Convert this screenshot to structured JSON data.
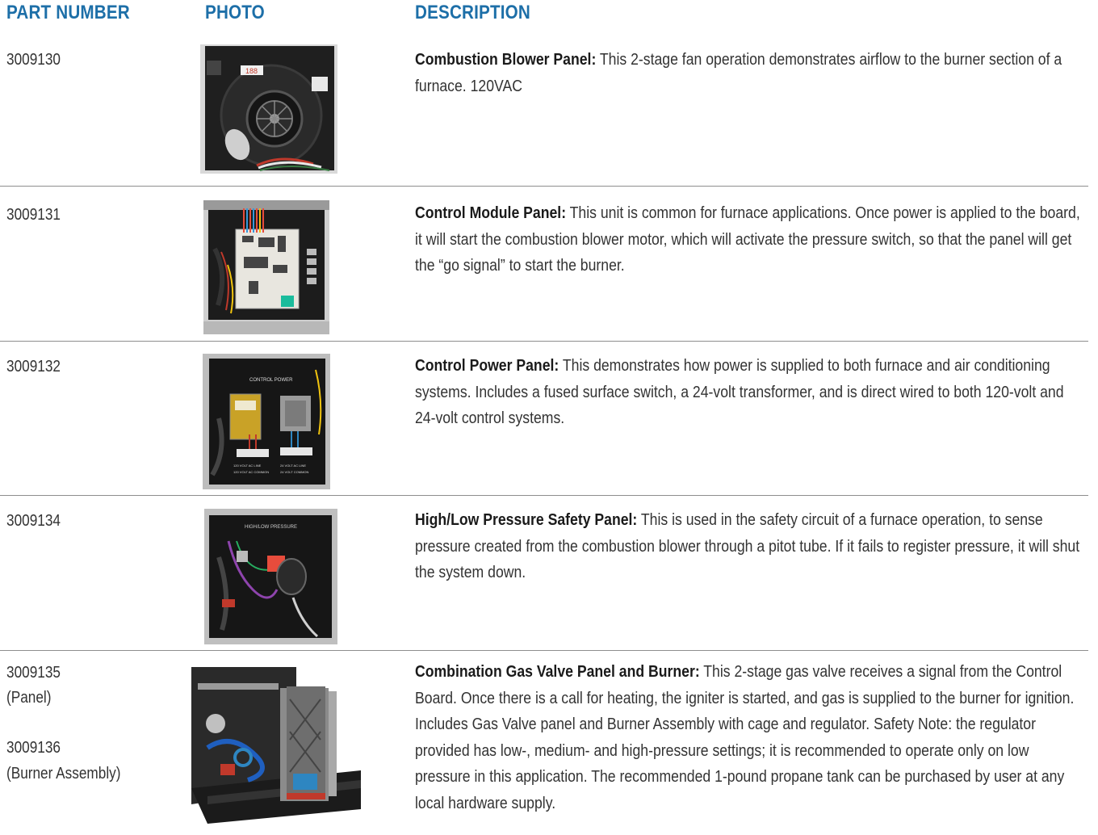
{
  "headers": {
    "part_number": "PART NUMBER",
    "photo": "PHOTO",
    "description": "DESCRIPTION"
  },
  "rows": [
    {
      "part_number": "3009130",
      "title": "Combustion Blower Panel:",
      "text": " This 2-stage fan operation demonstrates airflow to the burner section of a furnace. 120VAC"
    },
    {
      "part_number": "3009131",
      "title": "Control Module Panel:",
      "text": " This unit is common for furnace  applications. Once power is applied to the board, it will start the combustion blower motor, which will activate the pressure switch, so that the panel will get the “go signal” to start the burner."
    },
    {
      "part_number": "3009132",
      "title": "Control Power Panel:",
      "text": " This demonstrates how power is supplied to both furnace and air conditioning systems. Includes a fused surface switch, a 24-volt transformer, and is direct wired to both 120-volt and 24-volt control systems.",
      "photo_labels": [
        "CONTROL POWER",
        "120 VOLT AC LINE",
        "120 VOLT AC COMMON",
        "24 VOLT AC LINE",
        "24 VOLT COMMON"
      ]
    },
    {
      "part_number": "3009134",
      "title": "High/Low Pressure Safety Panel:",
      "text": " This is used in the safety circuit of a furnace operation, to sense pressure created from the combustion blower through a pitot tube. If it fails to register pressure, it will shut the system down.",
      "photo_labels": [
        "HIGH/LOW PRESSURE"
      ]
    },
    {
      "part_number": "3009135",
      "part_note": "(Panel)",
      "part_number_2": "3009136",
      "part_note_2": "(Burner Assembly)",
      "title": "Combination Gas Valve Panel and Burner:",
      "text": " This 2-stage gas valve receives a signal from the Control Board. Once there is a call for heating,  the igniter is started, and gas is supplied to the burner for ignition. Includes Gas Valve panel and Burner Assembly with cage and regulator.  Safety Note: the regulator provided has low-, medium- and high-pressure settings; it is recommended to operate only on low pressure in this application. The recommended 1-pound propane tank can be purchased by user at any local hardware supply."
    }
  ],
  "photo_misc": {
    "blower_sticker": "188"
  }
}
